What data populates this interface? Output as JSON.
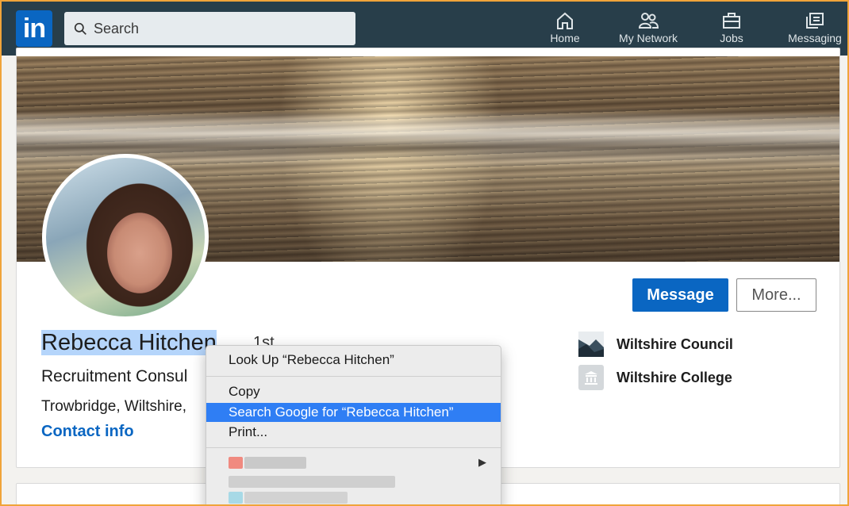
{
  "nav": {
    "search_placeholder": "Search",
    "items": [
      {
        "label": "Home",
        "icon": "home-icon"
      },
      {
        "label": "My Network",
        "icon": "network-icon"
      },
      {
        "label": "Jobs",
        "icon": "briefcase-icon"
      },
      {
        "label": "Messaging",
        "icon": "messaging-icon"
      }
    ],
    "logo": "in",
    "bar_color": "#283e4a",
    "brand_color": "#0a66c2"
  },
  "profile": {
    "name_selected": "Rebecca Hitchen",
    "degree": "1st",
    "headline": "Recruitment Consul",
    "location": "Trowbridge, Wiltshire,",
    "contact": "Contact info",
    "message_button": "Message",
    "more_button": "More...",
    "organizations": [
      {
        "name": "Wiltshire Council",
        "icon": "company-logo-icon"
      },
      {
        "name": "Wiltshire College",
        "icon": "school-icon"
      }
    ]
  },
  "context_menu": {
    "items": [
      {
        "label": "Look Up “Rebecca Hitchen”"
      },
      {
        "label": "Copy"
      },
      {
        "label": "Search Google for “Rebecca Hitchen”",
        "highlighted": true
      },
      {
        "label": "Print..."
      }
    ],
    "submenu_arrow": "▶",
    "highlight_color": "#2f7ef4"
  }
}
